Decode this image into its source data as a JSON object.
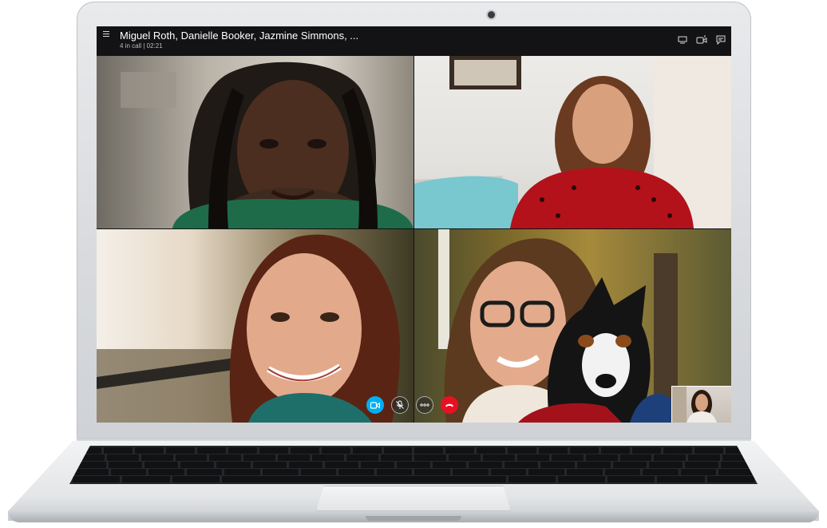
{
  "call": {
    "title": "Miguel Roth, Danielle Booker, Jazmine Simmons, ...",
    "status": "4 in call | 02:21"
  },
  "icons": {
    "menu": "menu-icon",
    "participants": "participants-icon",
    "switch_camera": "video-add-icon",
    "chat": "chat-icon",
    "video": "video-icon",
    "mute": "microphone-muted-icon",
    "more": "more-options-icon",
    "end_call": "end-call-icon"
  },
  "colors": {
    "accent": "#00aff0",
    "end_call": "#e81123",
    "topbar": "#141416"
  }
}
